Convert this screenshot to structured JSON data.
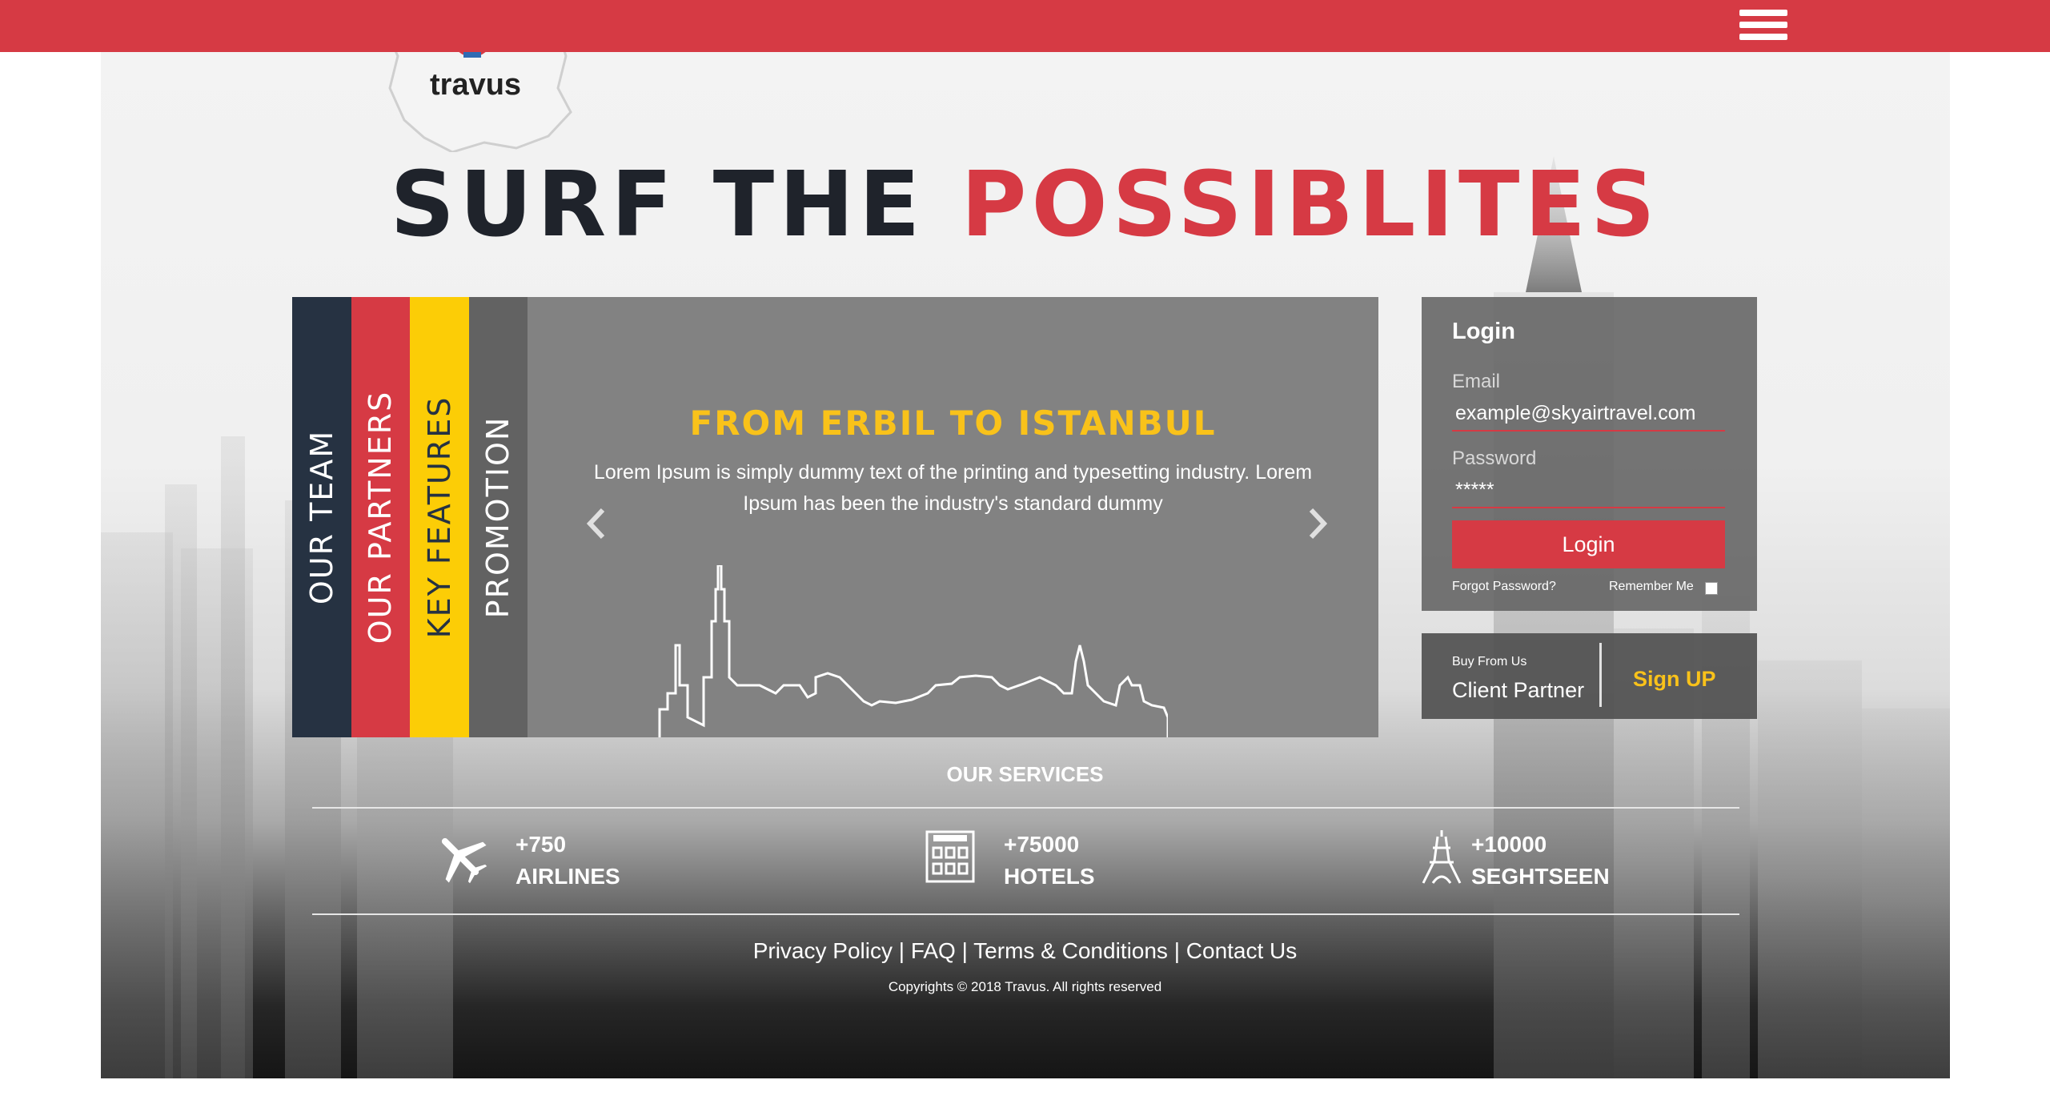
{
  "header": {
    "menu_icon": "hamburger-menu-icon",
    "accent_color": "#d63a44"
  },
  "logo": {
    "text": "travus",
    "mascot_icon": "owl-mascot-icon"
  },
  "hero": {
    "headline_dark": "SURF THE",
    "headline_red": "POSSIBLITES"
  },
  "tabs": [
    {
      "label": "OUR TEAM",
      "color": "#263242"
    },
    {
      "label": "OUR PARTNERS",
      "color": "#d63a44"
    },
    {
      "label": "KEY FEATURES",
      "color": "#fccd06"
    },
    {
      "label": "PROMOTION",
      "color": "#626262"
    }
  ],
  "slider": {
    "title": "FROM ERBIL TO ISTANBUL",
    "text": "Lorem Ipsum is simply dummy text of the printing and typesetting industry. Lorem Ipsum has been the industry's standard dummy",
    "prev_icon": "chevron-left-icon",
    "next_icon": "chevron-right-icon",
    "illustration": "city-skyline-outline"
  },
  "login": {
    "title": "Login",
    "email_label": "Email",
    "email_value": "example@skyairtravel.com",
    "password_label": "Password",
    "password_value": "*****",
    "button_label": "Login",
    "forgot_label": "Forgot Password?",
    "remember_label": "Remember Me"
  },
  "signup": {
    "buy_label": "Buy From Us",
    "client_label": "Client Partner",
    "button_label": "Sign UP"
  },
  "services": {
    "title": "OUR SERVICES",
    "items": [
      {
        "count": "+750",
        "label": "AIRLINES",
        "icon": "airplane-icon"
      },
      {
        "count": "+75000",
        "label": "HOTELS",
        "icon": "hotel-icon"
      },
      {
        "count": "+10000",
        "label": "SEGHTSEEN",
        "icon": "eiffel-tower-icon"
      }
    ]
  },
  "footer": {
    "links": [
      "Privacy Policy",
      "FAQ",
      "Terms & Conditions",
      "Contact Us"
    ],
    "separator": "|",
    "copyright": "Copyrights © 2018 Travus. All rights reserved"
  }
}
